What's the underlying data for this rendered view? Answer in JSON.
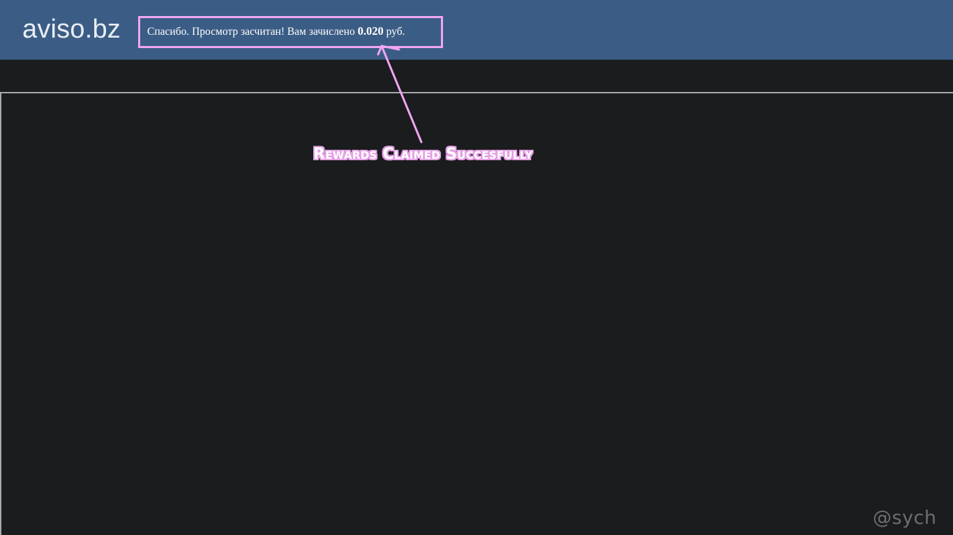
{
  "header": {
    "logo": "aviso.bz",
    "status_prefix": "Спасибо. Просмотр засчитан! Вам зачислено",
    "amount": "0.020",
    "currency": "руб."
  },
  "annotation": {
    "text": "Rewards Claimed Succesfully",
    "color": "#f0a6f0",
    "arrow_icon": "arrow-up-icon"
  },
  "watermark": "@sych",
  "colors": {
    "header_bg": "#3b5d85",
    "page_bg": "#1b1c1e",
    "frame_border": "#a9a9a9"
  }
}
